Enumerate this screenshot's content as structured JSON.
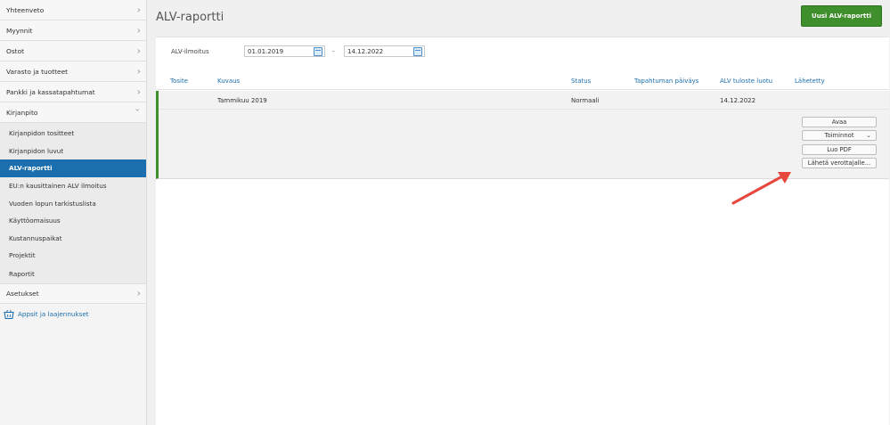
{
  "sidebar": {
    "top_items": [
      {
        "label": "Yhteenveto",
        "chevron": "›"
      },
      {
        "label": "Myynnit",
        "chevron": "›"
      },
      {
        "label": "Ostot",
        "chevron": "›"
      },
      {
        "label": "Varasto ja tuotteet",
        "chevron": "›"
      },
      {
        "label": "Pankki ja kassatapahtumat",
        "chevron": "›"
      },
      {
        "label": "Kirjanpito",
        "chevron": "⌄"
      }
    ],
    "sub_items": [
      {
        "label": "Kirjanpidon tositteet"
      },
      {
        "label": "Kirjanpidon luvut"
      },
      {
        "label": "ALV-raportti"
      },
      {
        "label": "EU:n kausittainen ALV ilmoitus"
      },
      {
        "label": "Vuoden lopun tarkistuslista"
      },
      {
        "label": "Käyttöomaisuus"
      },
      {
        "label": "Kustannuspaikat"
      },
      {
        "label": "Projektit"
      },
      {
        "label": "Raportit"
      }
    ],
    "settings": {
      "label": "Asetukset",
      "chevron": "›"
    },
    "apps": {
      "label": "Appsit ja laajennukset",
      "icon": "basket-icon"
    }
  },
  "header": {
    "title": "ALV-raportti",
    "new_button": "Uusi ALV-raportti"
  },
  "filter": {
    "label": "ALV-ilmoitus",
    "date_from": "01.01.2019",
    "date_to": "14.12.2022",
    "separator": "-"
  },
  "table": {
    "columns": [
      "Tosite",
      "Kuvaus",
      "Status",
      "Tapahtuman päiväys",
      "ALV tuloste luotu",
      "Lähetetty"
    ],
    "rows": [
      {
        "tosite": "",
        "kuvaus": "Tammikuu 2019",
        "status": "Normaali",
        "paivays": "",
        "luotu": "14.12.2022",
        "lahetetty": ""
      }
    ]
  },
  "row_actions": {
    "open": "Avaa",
    "actions": "Toiminnot",
    "actions_caret": "⌄",
    "create_pdf": "Luo PDF",
    "send": "Lähetä verottajalle..."
  },
  "colors": {
    "accent_blue": "#1c6fae",
    "brand_green": "#3f8f2c",
    "annotation_arrow": "#e8473d"
  }
}
